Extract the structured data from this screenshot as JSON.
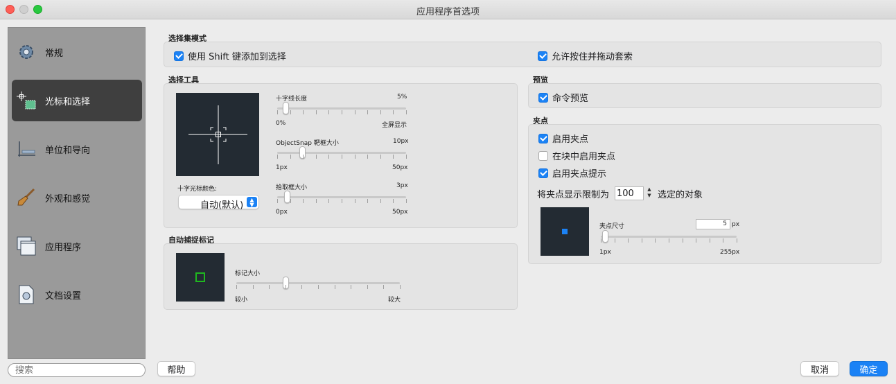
{
  "window": {
    "title": "应用程序首选项"
  },
  "sidebar": {
    "items": [
      {
        "label": "常规",
        "icon": "gear-icon"
      },
      {
        "label": "光标和选择",
        "icon": "crosshair-selection-icon"
      },
      {
        "label": "单位和导向",
        "icon": "ruler-icon"
      },
      {
        "label": "外观和感觉",
        "icon": "paintbrush-icon"
      },
      {
        "label": "应用程序",
        "icon": "windows-icon"
      },
      {
        "label": "文档设置",
        "icon": "document-icon"
      }
    ],
    "active_index": 1
  },
  "search": {
    "placeholder": "搜索"
  },
  "footer": {
    "help": "帮助",
    "cancel": "取消",
    "ok": "确定"
  },
  "selection_mode": {
    "title": "选择集模式",
    "use_shift": {
      "label": "使用 Shift 键添加到选择",
      "checked": true
    },
    "drag_lasso": {
      "label": "允许按住并拖动套索",
      "checked": true
    }
  },
  "selection_tools": {
    "title": "选择工具",
    "cursor_color_label": "十字光标颜色:",
    "cursor_color_value": "自动(默认)",
    "crosshair_length": {
      "label": "十字线长度",
      "value": "5%",
      "min": "0%",
      "max": "全屏显示",
      "fraction": 0.05
    },
    "objectsnap_size": {
      "label": "ObjectSnap 靶框大小",
      "value": "10px",
      "min": "1px",
      "max": "50px",
      "fraction": 0.19
    },
    "pickbox_size": {
      "label": "拾取框大小",
      "value": "3px",
      "min": "0px",
      "max": "50px",
      "fraction": 0.06
    }
  },
  "autosnap": {
    "title": "自动捕捉标记",
    "marker_size": {
      "label": "标记大小",
      "min": "较小",
      "max": "较大",
      "fraction": 0.3
    },
    "marker_color": "#1fb81f"
  },
  "preview": {
    "title": "预览",
    "command_preview": {
      "label": "命令预览",
      "checked": true
    }
  },
  "grips": {
    "title": "夹点",
    "enable": {
      "label": "启用夹点",
      "checked": true
    },
    "in_blocks": {
      "label": "在块中启用夹点",
      "checked": false
    },
    "tips": {
      "label": "启用夹点提示",
      "checked": true
    },
    "limit_prefix": "将夹点显示限制为",
    "limit_value": "100",
    "limit_suffix": "选定的对象",
    "grip_size": {
      "label": "夹点尺寸",
      "value": "5",
      "unit": "px",
      "min": "1px",
      "max": "255px",
      "fraction": 0.02
    },
    "grip_color": "#1b82f5"
  },
  "colors": {
    "accent": "#1b82f5",
    "preview_bg": "#232b33",
    "active_sidebar": "#3f3f3f"
  }
}
